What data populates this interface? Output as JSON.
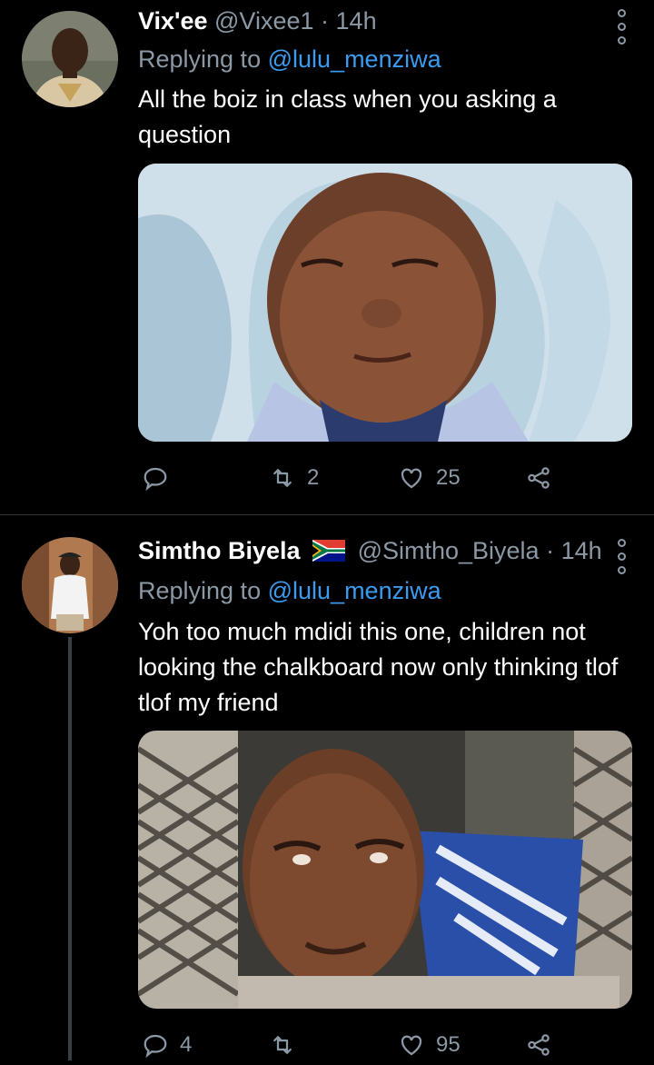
{
  "tweets": [
    {
      "display_name": "Vix'ee",
      "handle": "@Vixee1",
      "separator": "·",
      "time": "14h",
      "reply_prefix": "Replying to",
      "reply_handle": "@lulu_menziwa",
      "text": "All the boiz in class when you asking a question",
      "media_icon": "photo-baby-squinting",
      "actions": {
        "reply_count": "",
        "retweet_count": "2",
        "like_count": "25"
      }
    },
    {
      "display_name": "Simtho Biyela",
      "flag_icon": "south-africa-flag-icon",
      "handle": "@Simtho_Biyela",
      "separator": "·",
      "time": "14h",
      "reply_prefix": "Replying to",
      "reply_handle": "@lulu_menziwa",
      "text": "Yoh too much mdidi this one, children not looking the chalkboard now only  thinking tlof tlof my friend",
      "media_icon": "photo-man-at-window",
      "actions": {
        "reply_count": "4",
        "retweet_count": "",
        "like_count": "95"
      }
    }
  ],
  "colors": {
    "background": "#000000",
    "muted": "#8b98a5",
    "link": "#3c9bee",
    "divider": "#2f3336"
  }
}
